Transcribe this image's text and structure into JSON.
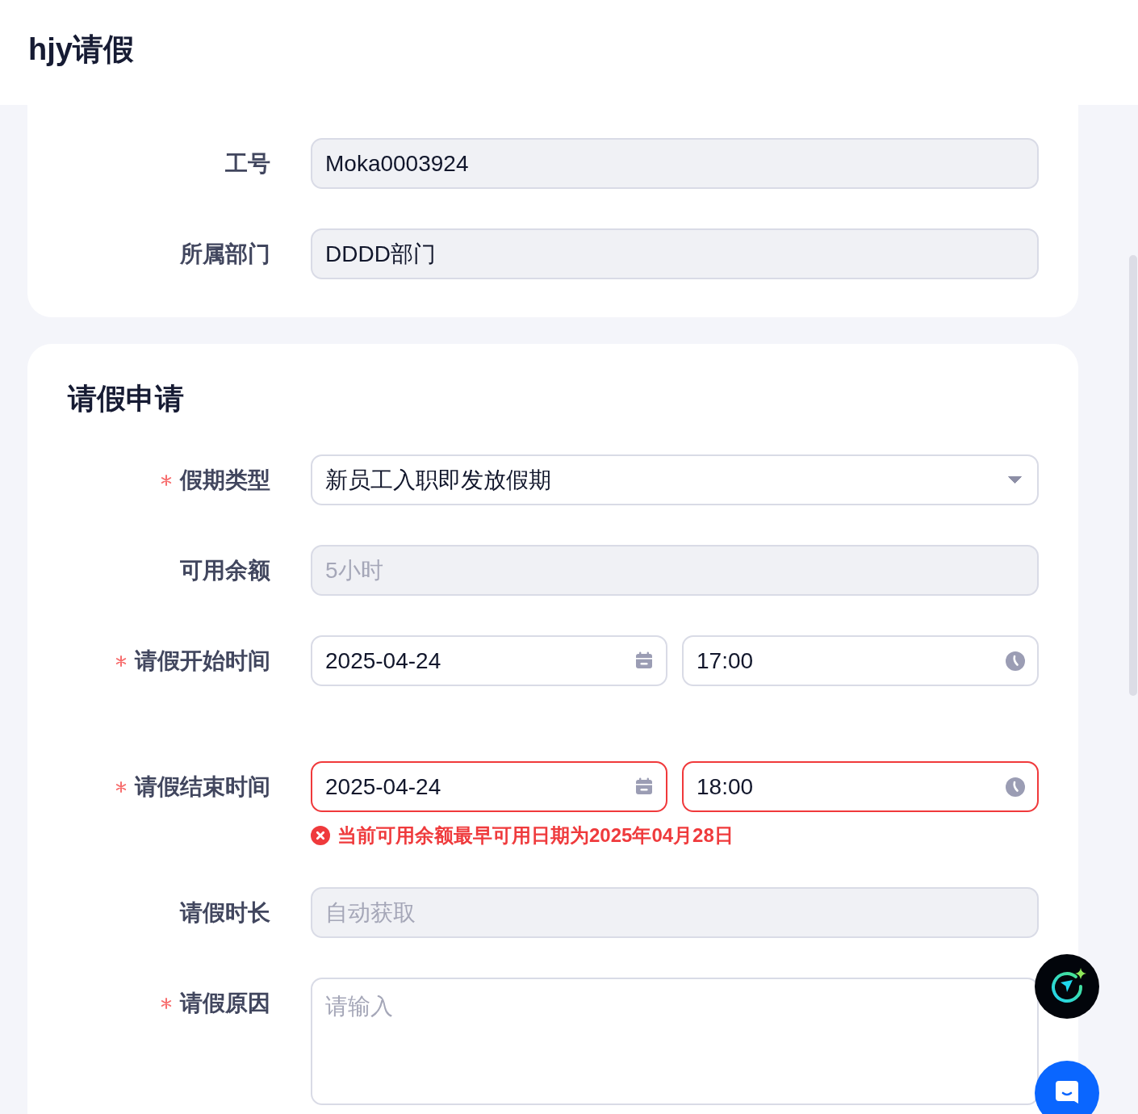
{
  "header": {
    "title": "hjy请假"
  },
  "basic_info": {
    "fields": [
      {
        "label": "工号",
        "value": "Moka0003924",
        "readonly": true
      },
      {
        "label": "所属部门",
        "value": "DDDD部门",
        "readonly": true
      }
    ]
  },
  "leave_application": {
    "title": "请假申请",
    "fields": [
      {
        "kind": "select",
        "label": "假期类型",
        "required": true,
        "value": "新员工入职即发放假期"
      },
      {
        "kind": "text",
        "label": "可用余额",
        "required": false,
        "disabled": true,
        "value": "5小时"
      },
      {
        "kind": "datetime",
        "label": "请假开始时间",
        "required": true,
        "date": "2025-04-24",
        "time": "17:00",
        "invalid": false
      },
      {
        "kind": "datetime",
        "label": "请假结束时间",
        "required": true,
        "date": "2025-04-24",
        "time": "18:00",
        "invalid": true,
        "error": "当前可用余额最早可用日期为2025年04月28日"
      },
      {
        "kind": "text",
        "label": "请假时长",
        "required": false,
        "disabled": true,
        "placeholder": "自动获取"
      },
      {
        "kind": "textarea",
        "label": "请假原因",
        "required": true,
        "placeholder": "请输入"
      }
    ]
  }
}
